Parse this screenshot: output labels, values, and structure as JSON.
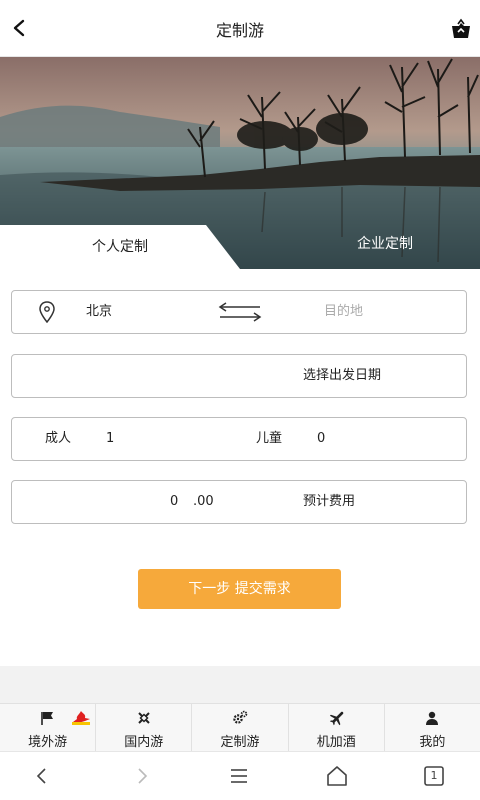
{
  "header": {
    "title": "定制游",
    "back_icon": "chevron-left-icon",
    "share_icon": "share-icon"
  },
  "tabs": {
    "personal": "个人定制",
    "enterprise": "企业定制"
  },
  "route": {
    "origin": "北京",
    "destination_placeholder": "目的地",
    "location_icon": "location-pin-icon",
    "swap_icon": "swap-arrows-icon"
  },
  "date": {
    "placeholder": "选择出发日期"
  },
  "travelers": {
    "adult_label": "成人",
    "adult_count": "1",
    "child_label": "儿童",
    "child_count": "0"
  },
  "budget": {
    "amount": "0",
    "decimals": ".00",
    "label": "预计费用"
  },
  "submit_label": "下一步 提交需求",
  "colors": {
    "accent": "#f6a93b",
    "border": "#bdbdbd",
    "page_bg": "#f2f2f2",
    "hot_badge": "#e02020"
  },
  "tabbar": {
    "items": [
      {
        "label": "境外游",
        "icon": "flag-icon",
        "badge": "hot-badge"
      },
      {
        "label": "国内游",
        "icon": "compass-icon"
      },
      {
        "label": "定制游",
        "icon": "gears-icon"
      },
      {
        "label": "机加酒",
        "icon": "airplane-icon"
      },
      {
        "label": "我的",
        "icon": "user-icon"
      }
    ]
  },
  "system_nav": {
    "back_icon": "nav-back-icon",
    "forward_icon": "nav-forward-icon",
    "menu_icon": "nav-menu-icon",
    "home_icon": "nav-home-icon",
    "tabs_icon": "nav-tabs-icon",
    "tab_count": "1"
  }
}
